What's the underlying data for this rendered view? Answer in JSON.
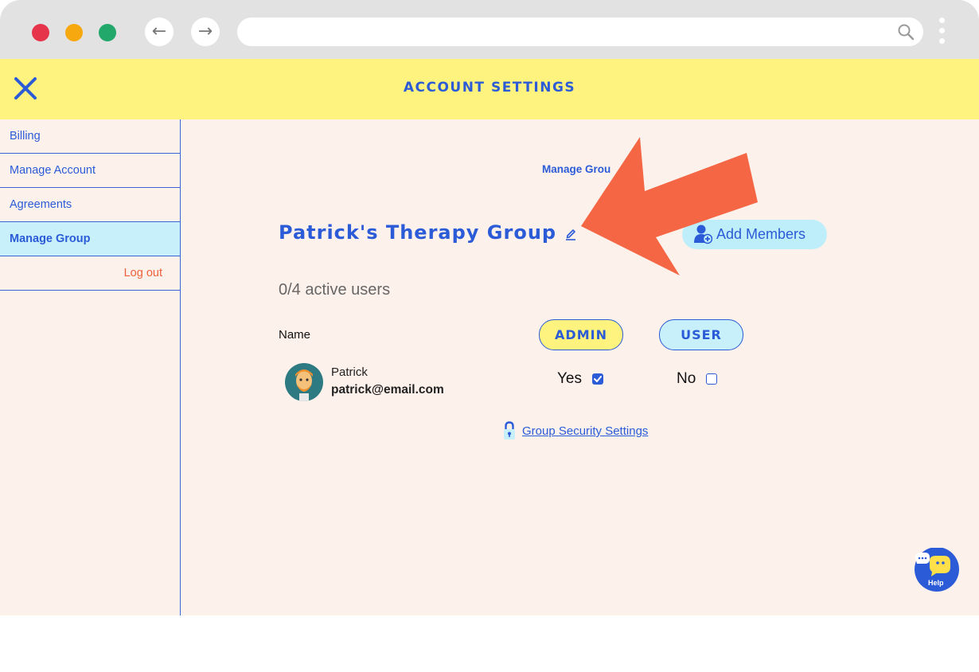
{
  "browser": {
    "traffic_lights": {
      "close": "#e6344a",
      "minimize": "#f7a80f",
      "maximize": "#22a86b"
    },
    "back_icon": "←",
    "forward_icon": "→"
  },
  "header": {
    "title": "ACCOUNT SETTINGS",
    "background": "#fff380",
    "accent": "#2b5bd7"
  },
  "sidebar": {
    "items": [
      {
        "label": "Billing"
      },
      {
        "label": "Manage Account"
      },
      {
        "label": "Agreements"
      },
      {
        "label": "Manage Group",
        "active": true
      }
    ],
    "logout_label": "Log out"
  },
  "main": {
    "breadcrumb": "Manage Grou",
    "group_name": "Patrick's Therapy Group",
    "add_members_label": "Add Members",
    "active_users": "0/4 active users",
    "columns": {
      "name": "Name",
      "admin": "ADMIN",
      "user": "USER"
    },
    "members": [
      {
        "name": "Patrick",
        "email": "patrick@email.com",
        "admin": "Yes",
        "admin_checked": true,
        "user": "No",
        "user_checked": false
      }
    ],
    "security_link": "Group Security Settings"
  },
  "help": {
    "label": "Help"
  }
}
